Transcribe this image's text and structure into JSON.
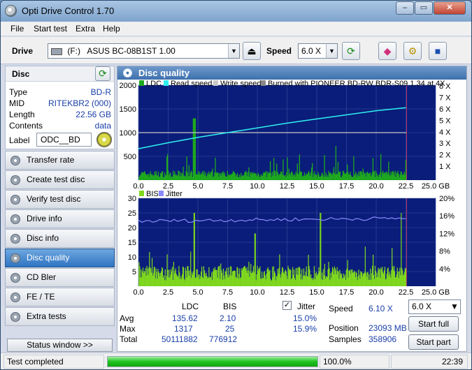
{
  "window": {
    "title": "Opti Drive Control 1.70",
    "min": "–",
    "max": "▭",
    "close": "✕"
  },
  "menu": [
    "File",
    "Start test",
    "Extra",
    "Help"
  ],
  "drivebar": {
    "drive_label": "Drive",
    "drive_letter": "(F:)",
    "drive_name": "ASUS BC-08B1ST 1.00",
    "speed_label": "Speed",
    "speed_value": "6.0 X"
  },
  "disc": {
    "header": "Disc",
    "rows": [
      {
        "k": "Type",
        "v": "BD-R"
      },
      {
        "k": "MID",
        "v": "RITEKBR2 (000)"
      },
      {
        "k": "Length",
        "v": "22.56 GB"
      },
      {
        "k": "Contents",
        "v": "data"
      }
    ],
    "label_key": "Label",
    "label_value": "ODC__BD"
  },
  "nav": [
    "Transfer rate",
    "Create test disc",
    "Verify test disc",
    "Drive info",
    "Disc info",
    "Disc quality",
    "CD Bler",
    "FE / TE",
    "Extra tests"
  ],
  "nav_selected": "Disc quality",
  "status_window_label": "Status window >>",
  "panel_title": "Disc quality",
  "chart_data": [
    {
      "type": "bar",
      "title": "",
      "legend": [
        "LDC",
        "Read speed",
        "Write speed",
        "Burned with PIONEER BD-RW   BDR-S09 1.34 at 4X"
      ],
      "colors": {
        "ldc": "#1fa81f",
        "read": "#2ff0f0",
        "write": "#c8c8c8",
        "burned": "#888888",
        "bg": "#0a1d7a"
      },
      "x_ticks": [
        "0.0",
        "2.5",
        "5.0",
        "7.5",
        "10.0",
        "12.5",
        "15.0",
        "17.5",
        "20.0",
        "22.5",
        "25.0 GB"
      ],
      "y_ticks_left": [
        "2000",
        "1500",
        "1000",
        "500"
      ],
      "y_ticks_right": [
        "8 X",
        "7 X",
        "6 X",
        "5 X",
        "4 X",
        "3 X",
        "2 X",
        "1 X"
      ],
      "xlim": [
        0,
        25
      ],
      "ylim": [
        0,
        2000
      ],
      "speed_lim": [
        0,
        8
      ],
      "read_speed": {
        "x": [
          0,
          2.5,
          5,
          7.5,
          10,
          12.5,
          15,
          17.5,
          20,
          22.5
        ],
        "y": [
          2.65,
          3.15,
          3.6,
          4.0,
          4.4,
          4.8,
          5.15,
          5.5,
          5.85,
          6.1
        ]
      },
      "write_speed_x": 4,
      "disc_end_gb": 22.56
    },
    {
      "type": "bar",
      "title": "",
      "legend": [
        "BIS",
        "Jitter"
      ],
      "colors": {
        "bis": "#7fd81f",
        "jitter": "#8a8aff",
        "bg": "#0a1d7a"
      },
      "x_ticks": [
        "0.0",
        "2.5",
        "5.0",
        "7.5",
        "10.0",
        "12.5",
        "15.0",
        "17.5",
        "20.0",
        "22.5",
        "25.0 GB"
      ],
      "y_ticks_left": [
        "30",
        "25",
        "20",
        "15",
        "10",
        "5"
      ],
      "y_ticks_right": [
        "20%",
        "16%",
        "12%",
        "8%",
        "4%"
      ],
      "xlim": [
        0,
        25
      ],
      "ylim": [
        0,
        30
      ],
      "jitter_lim": [
        0,
        20
      ],
      "jitter_avg_pct": 15.0
    }
  ],
  "stats": {
    "col_ldc": "LDC",
    "col_bis": "BIS",
    "jitter_label": "Jitter",
    "jitter_checked": true,
    "avg_label": "Avg",
    "avg_ldc": "135.62",
    "avg_bis": "2.10",
    "avg_jitter": "15.0%",
    "max_label": "Max",
    "max_ldc": "1317",
    "max_bis": "25",
    "max_jitter": "15.9%",
    "total_label": "Total",
    "total_ldc": "50111882",
    "total_bis": "776912",
    "speed_label": "Speed",
    "speed_value": "6.10 X",
    "position_label": "Position",
    "position_value": "23093 MB",
    "samples_label": "Samples",
    "samples_value": "358906",
    "speed_select": "6.0 X",
    "start_full": "Start full",
    "start_part": "Start part"
  },
  "statusbar": {
    "text": "Test completed",
    "progress": 1.0,
    "progress_text": "100.0%",
    "time": "22:39"
  }
}
